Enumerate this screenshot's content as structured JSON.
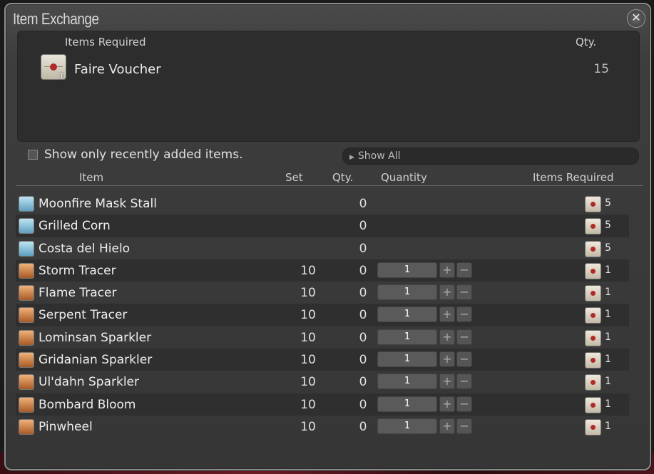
{
  "window": {
    "title": "Item Exchange",
    "close_icon": "close-icon"
  },
  "required_panel": {
    "header_items": "Items Required",
    "header_qty": "Qty.",
    "item_name": "Faire Voucher",
    "item_icon_count": "1",
    "item_qty": "15"
  },
  "filter": {
    "label": "Show only recently added items.",
    "checked": false
  },
  "category_dropdown": {
    "selected": "Show All"
  },
  "columns": {
    "item": "Item",
    "set": "Set",
    "qty": "Qty.",
    "quantity": "Quantity",
    "items_required": "Items Required"
  },
  "rows": [
    {
      "name": "Moonfire Mask Stall",
      "icon": "furnishing-icon",
      "set": "",
      "qty": "0",
      "quantity": "",
      "req": "5"
    },
    {
      "name": "Grilled Corn",
      "icon": "furnishing-icon",
      "set": "",
      "qty": "0",
      "quantity": "",
      "req": "5"
    },
    {
      "name": "Costa del Hielo",
      "icon": "furnishing-icon",
      "set": "",
      "qty": "0",
      "quantity": "",
      "req": "5"
    },
    {
      "name": "Storm Tracer",
      "icon": "firework-icon",
      "set": "10",
      "qty": "0",
      "quantity": "1",
      "req": "1"
    },
    {
      "name": "Flame Tracer",
      "icon": "firework-icon",
      "set": "10",
      "qty": "0",
      "quantity": "1",
      "req": "1"
    },
    {
      "name": "Serpent Tracer",
      "icon": "firework-icon",
      "set": "10",
      "qty": "0",
      "quantity": "1",
      "req": "1"
    },
    {
      "name": "Lominsan Sparkler",
      "icon": "firework-icon",
      "set": "10",
      "qty": "0",
      "quantity": "1",
      "req": "1"
    },
    {
      "name": "Gridanian Sparkler",
      "icon": "firework-icon",
      "set": "10",
      "qty": "0",
      "quantity": "1",
      "req": "1"
    },
    {
      "name": "Ul'dahn Sparkler",
      "icon": "firework-icon",
      "set": "10",
      "qty": "0",
      "quantity": "1",
      "req": "1"
    },
    {
      "name": "Bombard Bloom",
      "icon": "firework-icon",
      "set": "10",
      "qty": "0",
      "quantity": "1",
      "req": "1"
    },
    {
      "name": "Pinwheel",
      "icon": "firework-icon",
      "set": "10",
      "qty": "0",
      "quantity": "1",
      "req": "1"
    }
  ],
  "glyphs": {
    "close": "✕",
    "plus": "+",
    "minus": "−",
    "dropdown_arrow": "▶"
  }
}
